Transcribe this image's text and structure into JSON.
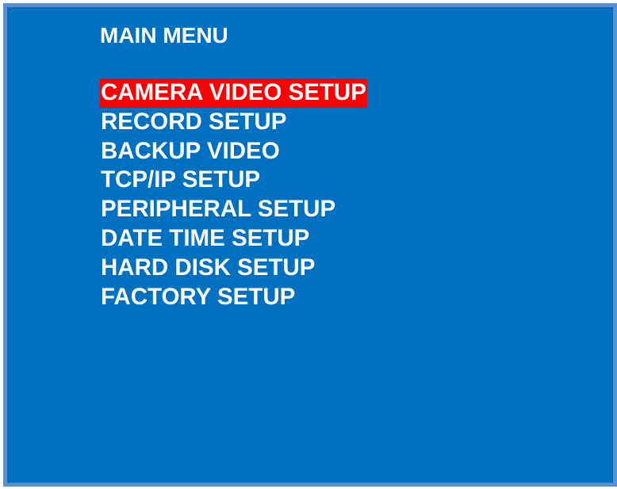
{
  "title": "MAIN MENU",
  "menu": {
    "selected_index": 0,
    "items": [
      {
        "label": "CAMERA VIDEO SETUP"
      },
      {
        "label": "RECORD SETUP"
      },
      {
        "label": "BACKUP VIDEO"
      },
      {
        "label": "TCP/IP SETUP"
      },
      {
        "label": "PERIPHERAL SETUP"
      },
      {
        "label": "DATE TIME SETUP"
      },
      {
        "label": "HARD DISK SETUP"
      },
      {
        "label": "FACTORY SETUP"
      }
    ]
  },
  "colors": {
    "background": "#0070c0",
    "border": "#5b8fd0",
    "text": "#ffffff",
    "highlight": "#ff0000"
  }
}
